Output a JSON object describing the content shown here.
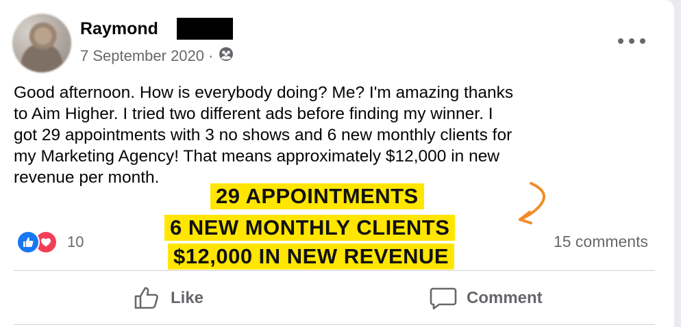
{
  "post": {
    "author": "Raymond",
    "date": "7 September 2020",
    "separator": "·",
    "audience_icon": "friends-icon",
    "body_lines": [
      "Good afternoon. How is everybody doing? Me? I'm amazing thanks",
      "to Aim Higher. I tried two different ads before finding my winner. I",
      "got 29 appointments with 3 no shows and 6 new monthly clients for",
      "my Marketing Agency! That means approximately $12,000 in new",
      "revenue per month."
    ]
  },
  "highlights": [
    "29 APPOINTMENTS",
    "6 NEW MONTHLY CLIENTS",
    "$12,000 IN NEW REVENUE"
  ],
  "reactions": {
    "count": "10",
    "icons": [
      "like-icon",
      "love-icon"
    ]
  },
  "comments_label": "15 comments",
  "actions": {
    "like_label": "Like",
    "comment_label": "Comment"
  },
  "colors": {
    "highlight": "#ffe600",
    "arrow": "#f28c28",
    "like": "#1877f2",
    "love": "#f33e58",
    "muted": "#65676b"
  }
}
